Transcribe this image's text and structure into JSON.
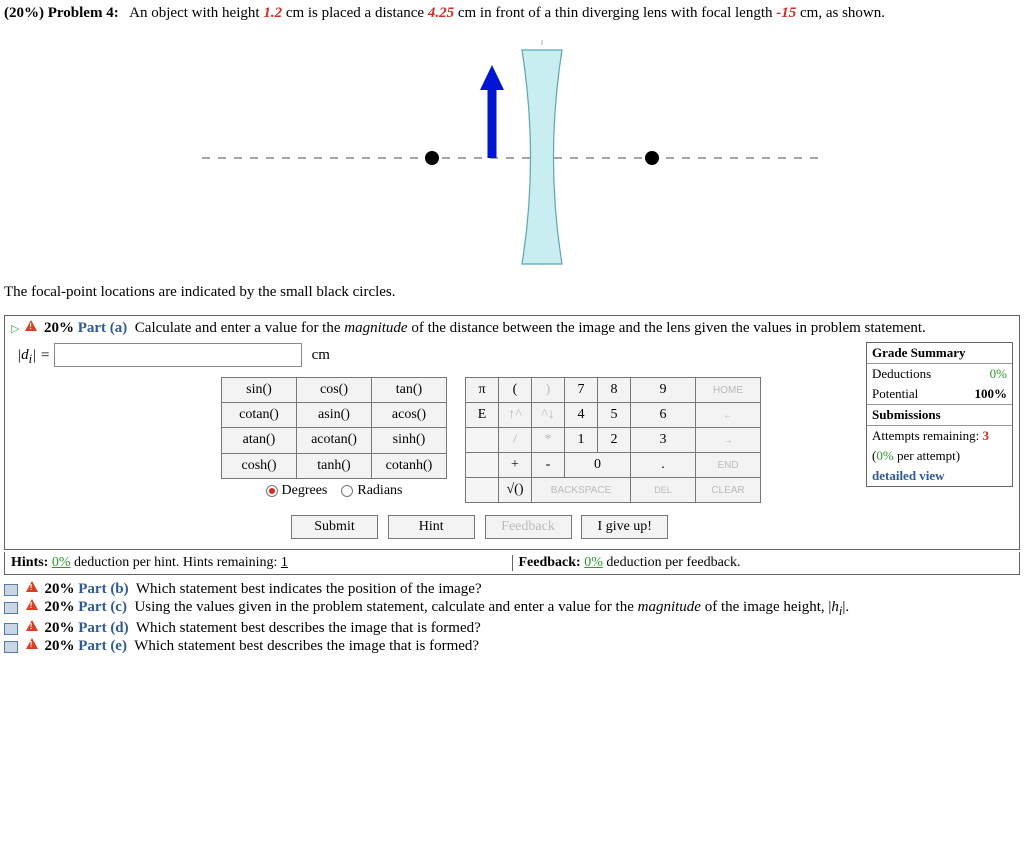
{
  "problem": {
    "weight": "(20%)",
    "label": "Problem 4:",
    "text_a": "An object with height",
    "val_height": "1.2",
    "text_b": "cm is placed a distance",
    "val_dist": "4.25",
    "text_c": "cm in front of a thin diverging lens with focal length",
    "val_focal": "-15",
    "text_d": "cm, as shown.",
    "focal_note": "The focal-point locations are indicated by the small black circles."
  },
  "part_a": {
    "percent": "20%",
    "label": "Part (a)",
    "prompt_a": "Calculate and enter a value for the",
    "prompt_em": "magnitude",
    "prompt_b": "of the distance between the image and the lens given the values in problem statement.",
    "var": "|d_i| =",
    "unit": "cm"
  },
  "funcs": {
    "r1": [
      "sin()",
      "cos()",
      "tan()"
    ],
    "r2": [
      "cotan()",
      "asin()",
      "acos()"
    ],
    "r3": [
      "atan()",
      "acotan()",
      "sinh()"
    ],
    "r4": [
      "cosh()",
      "tanh()",
      "cotanh()"
    ],
    "mode_deg": "Degrees",
    "mode_rad": "Radians"
  },
  "nums": {
    "r1": [
      "π",
      "(",
      ")",
      "7",
      "8",
      "9",
      "HOME"
    ],
    "r2": [
      "E",
      "↑^",
      "^↓",
      "4",
      "5",
      "6",
      "←"
    ],
    "r3": [
      "",
      "/",
      "*",
      "1",
      "2",
      "3",
      "→"
    ],
    "r4": [
      "",
      "+",
      "-",
      "0",
      ".",
      "END"
    ],
    "r5": [
      "",
      "√()",
      "BACKSPACE",
      "DEL",
      "CLEAR"
    ]
  },
  "actions": {
    "submit": "Submit",
    "hint": "Hint",
    "feedback": "Feedback",
    "giveup": "I give up!"
  },
  "grade": {
    "title": "Grade Summary",
    "ded_label": "Deductions",
    "ded_val": "0%",
    "pot_label": "Potential",
    "pot_val": "100%",
    "sub_title": "Submissions",
    "att_label": "Attempts remaining:",
    "att_val": "3",
    "per_att": "(0% per attempt)",
    "detail": "detailed view"
  },
  "hints": {
    "left_a": "Hints:",
    "left_pct": "0%",
    "left_b": "deduction per hint. Hints remaining:",
    "left_remain": "1",
    "right_a": "Feedback:",
    "right_pct": "0%",
    "right_b": "deduction per feedback."
  },
  "subs": {
    "b": {
      "pct": "20%",
      "lbl": "Part (b)",
      "txt": "Which statement best indicates the position of the image?"
    },
    "c": {
      "pct": "20%",
      "lbl": "Part (c)",
      "txt_a": "Using the values given in the problem statement, calculate and enter a value for the",
      "em": "magnitude",
      "txt_b": "of the image height, |h_i|."
    },
    "d": {
      "pct": "20%",
      "lbl": "Part (d)",
      "txt": "Which statement best describes the image that is formed?"
    },
    "e": {
      "pct": "20%",
      "lbl": "Part (e)",
      "txt": "Which statement best describes the image that is formed?"
    }
  }
}
